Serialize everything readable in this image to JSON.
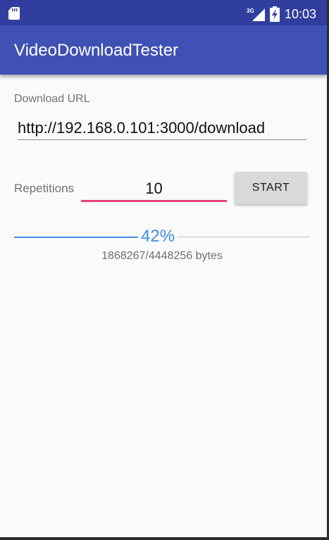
{
  "status_bar": {
    "time": "10:03",
    "network": "3G",
    "icons": [
      "sd-card-icon",
      "cell-signal-icon",
      "battery-charging-icon"
    ]
  },
  "app_bar": {
    "title": "VideoDownloadTester"
  },
  "form": {
    "url_label": "Download URL",
    "url_value": "http://192.168.0.101:3000/download",
    "repetitions_label": "Repetitions",
    "repetitions_value": "10",
    "start_label": "START"
  },
  "progress": {
    "percent_text": "42%",
    "fraction": 0.42,
    "bytes_text": "1868267/4448256 bytes"
  },
  "colors": {
    "status_bar": "#303f9f",
    "app_bar": "#3f51b5",
    "accent": "#ec407a",
    "progress": "#3f8ee8",
    "background": "#fafafa"
  }
}
